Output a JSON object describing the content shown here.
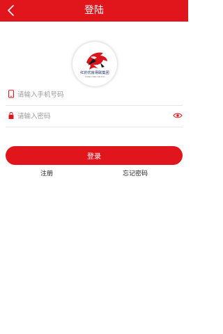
{
  "header": {
    "title": "登陆",
    "back_icon": "chevron-left-icon"
  },
  "logo": {
    "icon": "company-logo",
    "caption": "红豹优房易联集团",
    "subcaption": "HONGBAO YOUFANG YILIAN GROUP"
  },
  "form": {
    "phone": {
      "placeholder": "请输入手机号码",
      "value": "",
      "icon": "phone-icon"
    },
    "password": {
      "placeholder": "请输入密码",
      "value": "",
      "icon": "lock-icon",
      "toggle_icon": "eye-icon"
    }
  },
  "actions": {
    "login_label": "登录",
    "register_label": "注册",
    "forgot_label": "忘记密码"
  },
  "colors": {
    "primary": "#e0161c",
    "background": "#ffffff",
    "placeholder": "#9a9a9a"
  }
}
